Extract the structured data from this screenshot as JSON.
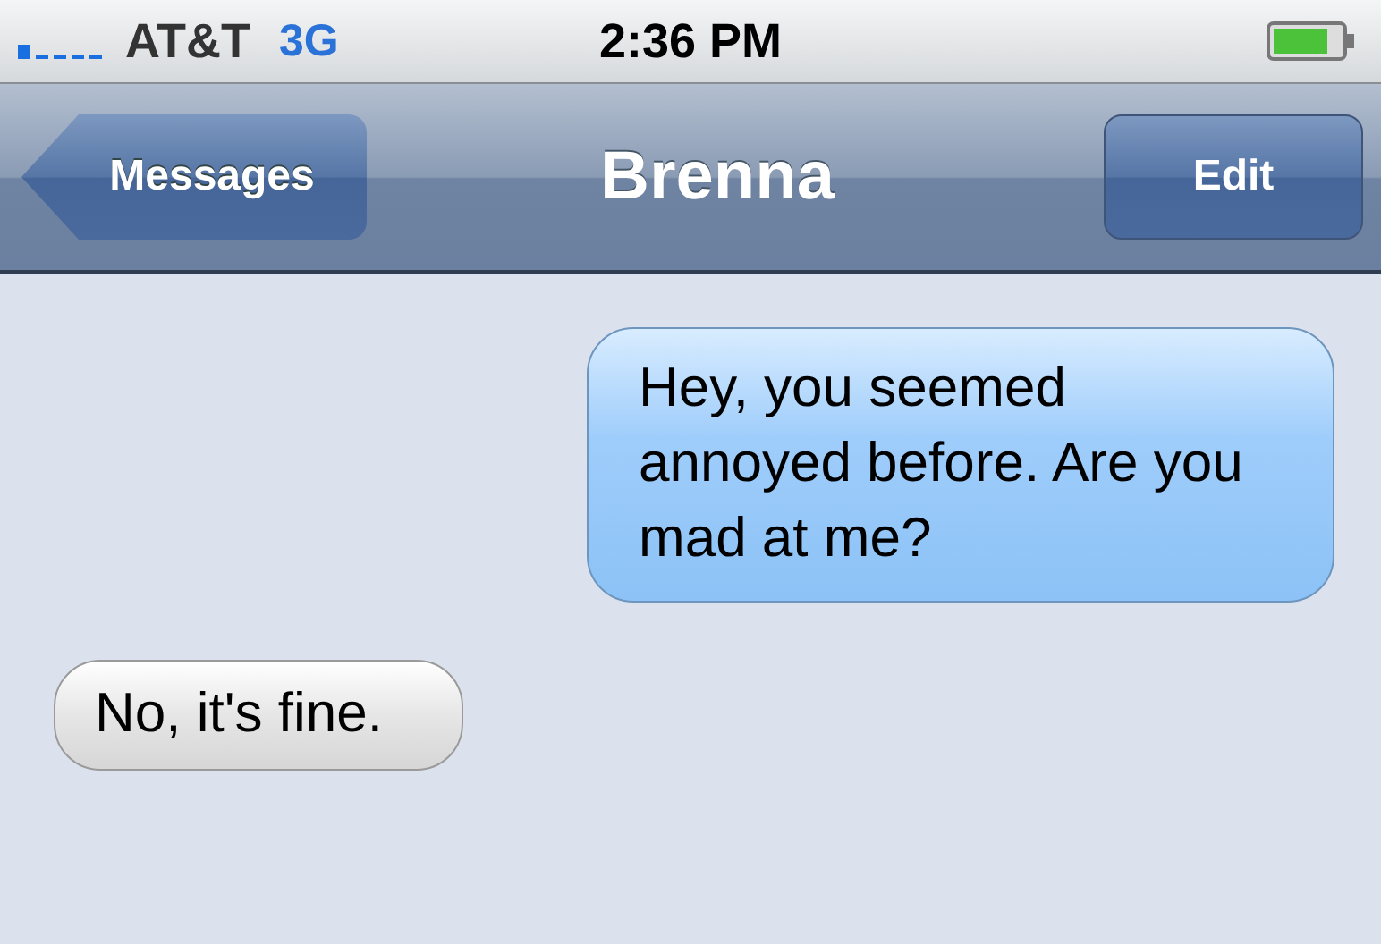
{
  "status_bar": {
    "carrier": "AT&T",
    "network": "3G",
    "time": "2:36 PM"
  },
  "nav_bar": {
    "back_button": "Messages",
    "title": "Brenna",
    "edit_button": "Edit"
  },
  "messages": [
    {
      "kind": "sent",
      "text": "Hey, you seemed annoyed before. Are you mad at me?"
    },
    {
      "kind": "received",
      "text": "No, it's fine."
    }
  ]
}
